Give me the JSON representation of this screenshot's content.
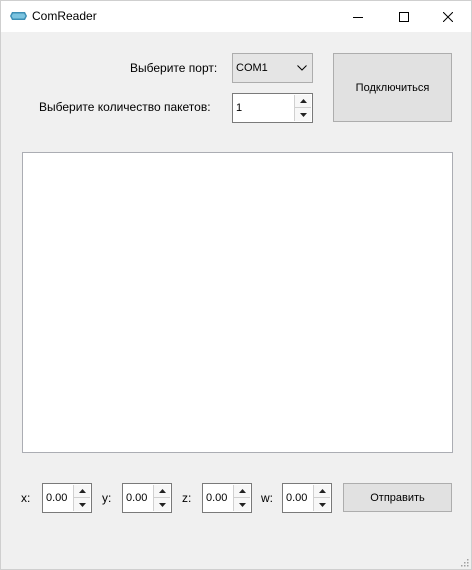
{
  "window": {
    "title": "ComReader",
    "icon": "serial-port-icon",
    "controls": [
      "minimize-icon",
      "maximize-icon",
      "close-icon"
    ]
  },
  "port": {
    "label": "Выберите порт:",
    "selected": "COM1"
  },
  "packets": {
    "label": "Выберите количество пакетов:",
    "value": "1"
  },
  "connect_button": "Подключиться",
  "output": {
    "text": ""
  },
  "coords": {
    "x_label": "x:",
    "x_value": "0.00",
    "y_label": "y:",
    "y_value": "0.00",
    "z_label": "z:",
    "z_value": "0.00",
    "w_label": "w:",
    "w_value": "0.00"
  },
  "send_button": "Отправить"
}
